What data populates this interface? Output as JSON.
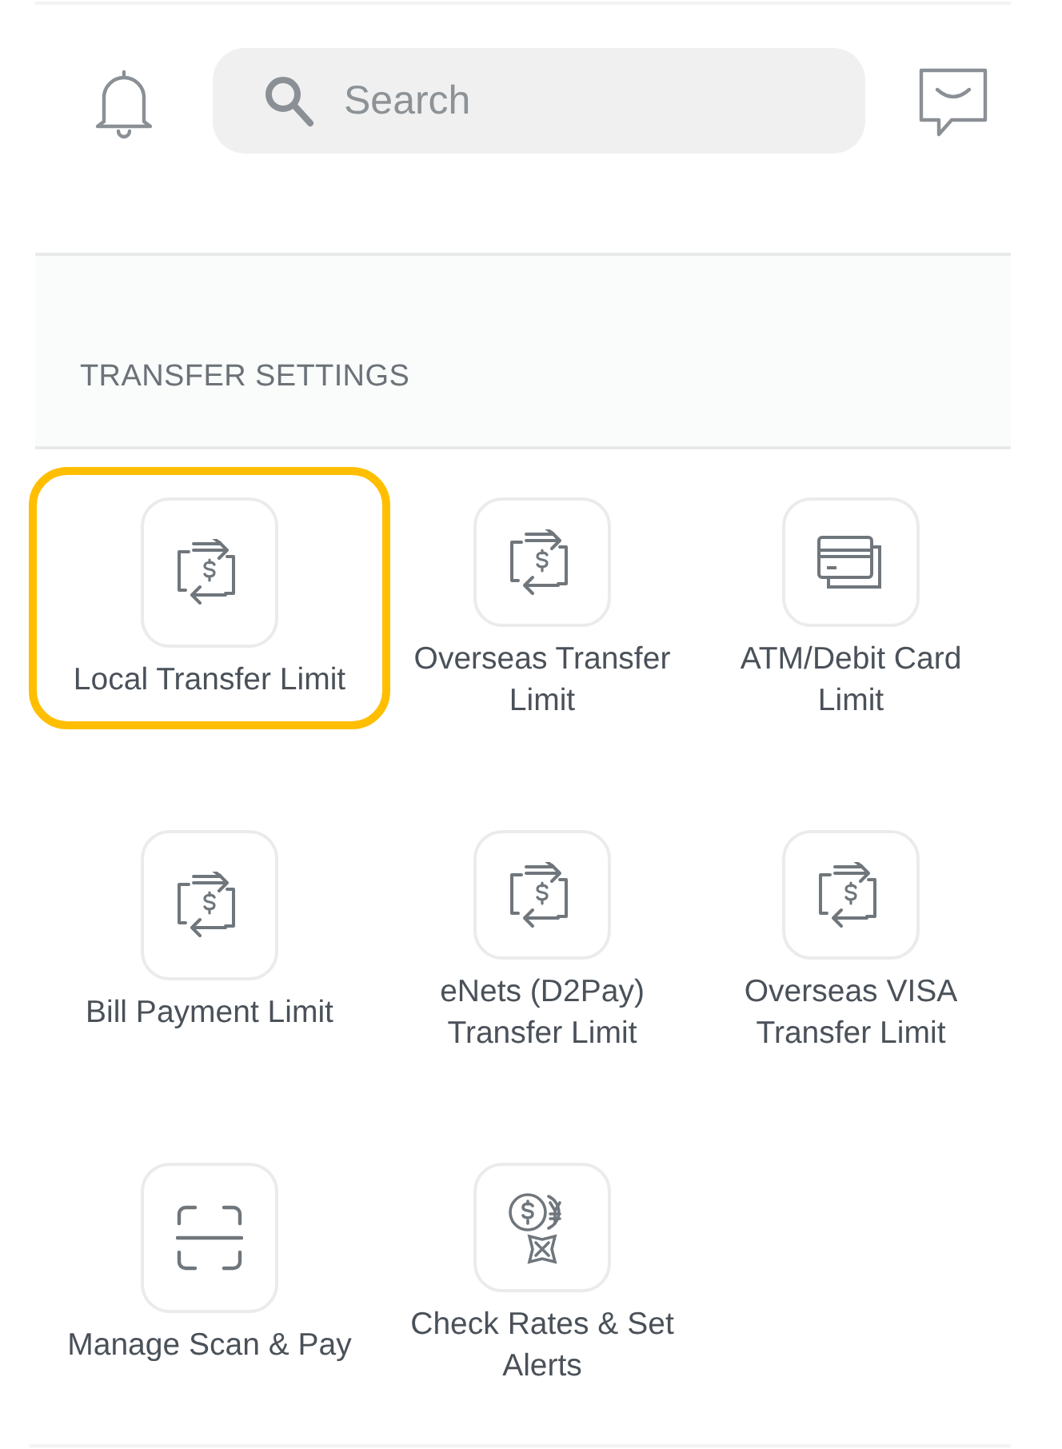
{
  "search": {
    "placeholder": "Search"
  },
  "section": {
    "heading": "TRANSFER SETTINGS"
  },
  "items": [
    {
      "label": "Local Transfer Limit",
      "kind": "transfer",
      "highlighted": true
    },
    {
      "label": "Overseas Transfer Limit",
      "kind": "transfer",
      "highlighted": false
    },
    {
      "label": "ATM/Debit Card Limit",
      "kind": "card",
      "highlighted": false
    },
    {
      "label": "Bill Payment Limit",
      "kind": "transfer",
      "highlighted": false
    },
    {
      "label": "eNets (D2Pay) Transfer Limit",
      "kind": "transfer",
      "highlighted": false
    },
    {
      "label": "Overseas VISA Transfer Limit",
      "kind": "transfer",
      "highlighted": false
    },
    {
      "label": "Manage Scan & Pay",
      "kind": "scan",
      "highlighted": false
    },
    {
      "label": "Check Rates & Set Alerts",
      "kind": "rates",
      "highlighted": false
    }
  ]
}
